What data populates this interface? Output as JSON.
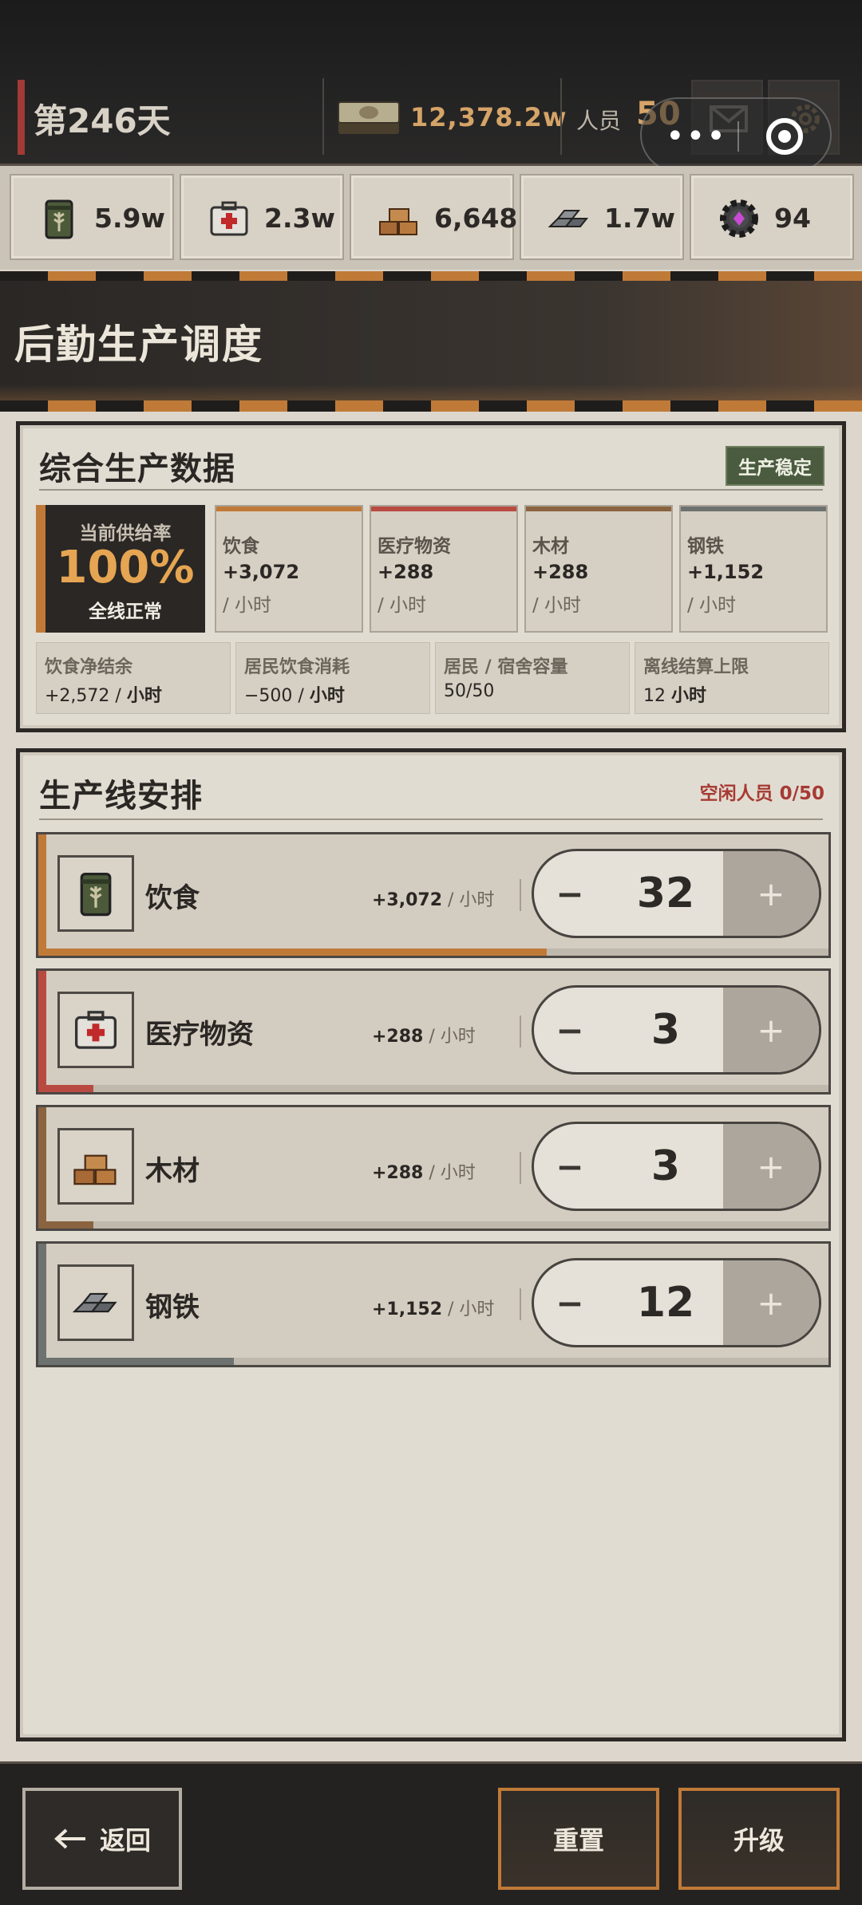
{
  "topbar": {
    "day": "第246天",
    "money": "12,378.2w",
    "people_label": "人员",
    "people_value": "50",
    "menu_dots": "•••"
  },
  "resources": [
    {
      "icon": "grain-sack-icon",
      "value": "5.9w"
    },
    {
      "icon": "medkit-icon",
      "value": "2.3w"
    },
    {
      "icon": "wood-icon",
      "value": "6,648"
    },
    {
      "icon": "steel-ingot-icon",
      "value": "1.7w"
    },
    {
      "icon": "gear-gem-icon",
      "value": "94"
    }
  ],
  "section": {
    "title": "后勤生产调度"
  },
  "overview": {
    "title": "综合生产数据",
    "badge": "生产稳定",
    "rate_label": "当前供给率",
    "rate_value": "100%",
    "rate_status": "全线正常",
    "outputs": [
      {
        "name": "饮食",
        "value": "+3,072",
        "unit": "/ 小时",
        "color": "#c07a38"
      },
      {
        "name": "医疗物资",
        "value": "+288",
        "unit": "/ 小时",
        "color": "#b94a42"
      },
      {
        "name": "木材",
        "value": "+288",
        "unit": "/ 小时",
        "color": "#8a6440"
      },
      {
        "name": "钢铁",
        "value": "+1,152",
        "unit": "/ 小时",
        "color": "#6d7270"
      }
    ],
    "stats": [
      {
        "label": "饮食净结余",
        "value": "+2,572 /",
        "unit": "小时"
      },
      {
        "label": "居民饮食消耗",
        "value": "−500 /",
        "unit": "小时"
      },
      {
        "label": "居民 / 宿舍容量",
        "value": "50/50",
        "unit": ""
      },
      {
        "label": "离线结算上限",
        "value": "12",
        "unit": "小时"
      }
    ]
  },
  "lines": {
    "title": "生产线安排",
    "idle": "空闲人员 0/50",
    "items": [
      {
        "name": "饮食",
        "rate": "+3,072",
        "unit": "/ 小时",
        "count": "32",
        "minus": "−",
        "plus": "+",
        "progress": 0.64,
        "color": "#c07a38"
      },
      {
        "name": "医疗物资",
        "rate": "+288",
        "unit": "/ 小时",
        "count": "3",
        "minus": "−",
        "plus": "+",
        "progress": 0.06,
        "color": "#b94a42"
      },
      {
        "name": "木材",
        "rate": "+288",
        "unit": "/ 小时",
        "count": "3",
        "minus": "−",
        "plus": "+",
        "progress": 0.06,
        "color": "#8a6440"
      },
      {
        "name": "钢铁",
        "rate": "+1,152",
        "unit": "/ 小时",
        "count": "12",
        "minus": "−",
        "plus": "+",
        "progress": 0.24,
        "color": "#6d7270"
      }
    ]
  },
  "footer": {
    "back": "返回",
    "reset": "重置",
    "upgrade": "升级"
  }
}
